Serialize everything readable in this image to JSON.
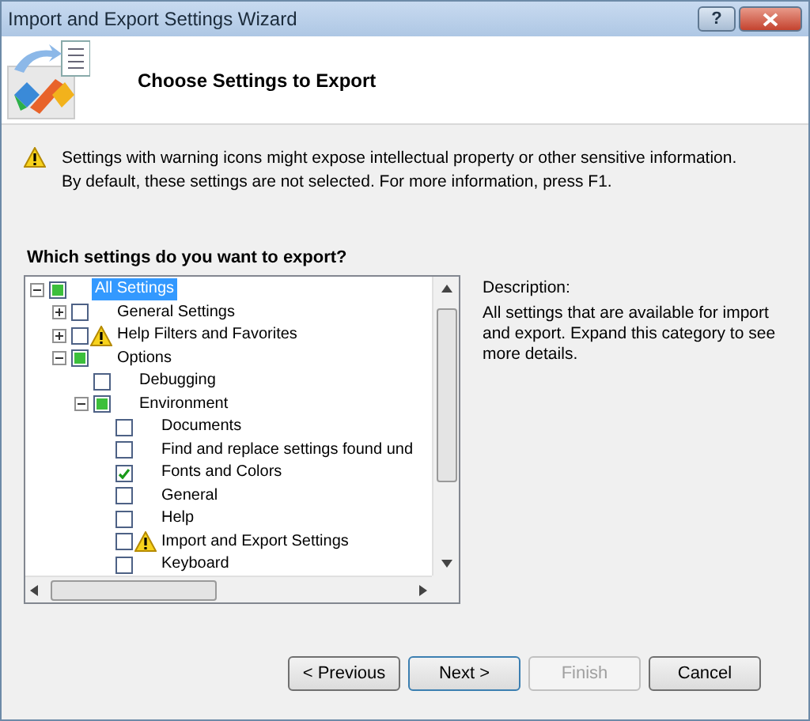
{
  "window": {
    "title": "Import and Export Settings Wizard",
    "help_button": "?"
  },
  "header": {
    "title": "Choose Settings to Export"
  },
  "warning": "Settings with warning icons might expose intellectual property or other sensitive information. By default, these settings are not selected. For more information, press F1.",
  "tree_label": "Which settings do you want to export?",
  "tree": [
    {
      "label": "All Settings",
      "checked": false,
      "partial": true,
      "selected": true,
      "expanded": true,
      "warning": false,
      "children": [
        {
          "label": "General Settings",
          "checked": false,
          "partial": false,
          "selected": false,
          "expanded": false,
          "expandable": true,
          "warning": false
        },
        {
          "label": "Help Filters and Favorites",
          "checked": false,
          "partial": false,
          "selected": false,
          "expanded": false,
          "expandable": true,
          "warning": true
        },
        {
          "label": "Options",
          "checked": false,
          "partial": true,
          "selected": false,
          "expanded": true,
          "warning": false,
          "children": [
            {
              "label": "Debugging",
              "checked": false,
              "partial": false,
              "selected": false,
              "warning": false
            },
            {
              "label": "Environment",
              "checked": false,
              "partial": true,
              "selected": false,
              "expanded": true,
              "warning": false,
              "children": [
                {
                  "label": "Documents",
                  "checked": false,
                  "partial": false,
                  "selected": false,
                  "warning": false
                },
                {
                  "label": "Find and replace settings found und",
                  "checked": false,
                  "partial": false,
                  "selected": false,
                  "warning": false
                },
                {
                  "label": "Fonts and Colors",
                  "checked": true,
                  "partial": false,
                  "selected": false,
                  "warning": false
                },
                {
                  "label": "General",
                  "checked": false,
                  "partial": false,
                  "selected": false,
                  "warning": false
                },
                {
                  "label": "Help",
                  "checked": false,
                  "partial": false,
                  "selected": false,
                  "warning": false
                },
                {
                  "label": "Import and Export Settings",
                  "checked": false,
                  "partial": false,
                  "selected": false,
                  "warning": true
                },
                {
                  "label": "Keyboard",
                  "checked": false,
                  "partial": false,
                  "selected": false,
                  "warning": false
                }
              ]
            }
          ]
        }
      ]
    }
  ],
  "description": {
    "label": "Description:",
    "text": "All settings that are available for import and export. Expand this category to see more details."
  },
  "buttons": [
    {
      "label": "< Previous",
      "disabled": false,
      "default": false
    },
    {
      "label": "Next >",
      "disabled": false,
      "default": true
    },
    {
      "label": "Finish",
      "disabled": true,
      "default": false
    },
    {
      "label": "Cancel",
      "disabled": false,
      "default": false
    }
  ]
}
